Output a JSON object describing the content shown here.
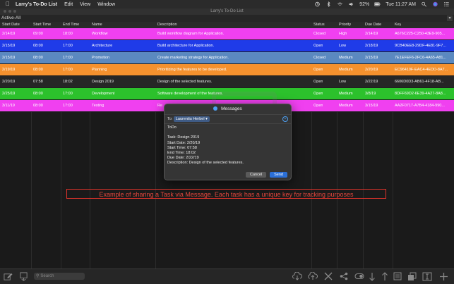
{
  "menubar": {
    "app_name": "Larry's To-Do List",
    "items": [
      "Edit",
      "View",
      "Window"
    ],
    "battery": "92%",
    "clock": "Tue 11:27 AM"
  },
  "window": {
    "title": "Larry's To-Do List"
  },
  "filter": {
    "label": "Active-All"
  },
  "columns": [
    "Start Date",
    "Start Time",
    "End Time",
    "Name",
    "Description",
    "Status",
    "Priority",
    "Due Date",
    "Key"
  ],
  "rows": [
    {
      "start_date": "2/14/19",
      "start_time": "09:00",
      "end_time": "18:00",
      "name": "Workflow",
      "description": "Build workflow diagram for Application.",
      "status": "Closed",
      "priority": "High",
      "due_date": "2/14/19",
      "key": "A676C225-C250-43E9-905...",
      "color": "#f040f0",
      "text_color": "#ffffff"
    },
    {
      "start_date": "2/15/19",
      "start_time": "08:00",
      "end_time": "17:00",
      "name": "Architecture",
      "description": "Build architecture for Application.",
      "status": "Open",
      "priority": "Low",
      "due_date": "2/18/19",
      "key": "9CB40EE8-29DF-4E81-9F7...",
      "color": "#1f3be8",
      "text_color": "#ffffff"
    },
    {
      "start_date": "2/15/19",
      "start_time": "08:00",
      "end_time": "17:00",
      "name": "Promotion",
      "description": "Create marketing strategy for Application.",
      "status": "Closed",
      "priority": "Medium",
      "due_date": "2/15/19",
      "key": "7E1EFEF6-2FC6-4A65-A81...",
      "color": "#5b89c0",
      "text_color": "#ffffff"
    },
    {
      "start_date": "2/19/19",
      "start_time": "08:00",
      "end_time": "17:00",
      "name": "Planning",
      "description": "Prioritizing the features to be developed.",
      "status": "Open",
      "priority": "Medium",
      "due_date": "2/20/19",
      "key": "EC96410F-EAC4-4EDD-8A7...",
      "color": "#f5912e",
      "text_color": "#ffffff"
    },
    {
      "start_date": "2/20/19",
      "start_time": "07:58",
      "end_time": "18:02",
      "name": "Design 2019",
      "description": "Design of the selected features.",
      "status": "Open",
      "priority": "Low",
      "due_date": "2/22/19",
      "key": "6606D0D3-AB61-4F18-AB...",
      "color": "#262626",
      "text_color": "#e8e8e8"
    },
    {
      "start_date": "2/25/19",
      "start_time": "08:00",
      "end_time": "17:00",
      "name": "Development",
      "description": "Software development of the features.",
      "status": "Open",
      "priority": "Medium",
      "due_date": "3/8/19",
      "key": "8DFF69D2-6E39-4A27-8A8...",
      "color": "#2cc12c",
      "text_color": "#ffffff"
    },
    {
      "start_date": "3/11/19",
      "start_time": "08:00",
      "end_time": "17:00",
      "name": "Testing",
      "description": "Re",
      "status": "Open",
      "priority": "Medium",
      "due_date": "3/15/19",
      "key": "AA2F0717-A7B4-4184-990...",
      "color": "#f040f0",
      "text_color": "#ffffff"
    }
  ],
  "dialog": {
    "title": "Messages",
    "to_label": "To:",
    "recipient": "Laurentiu Herbel",
    "body_lines": [
      "ToDo",
      "",
      "Task: Design 2019",
      "Start Date: 2/20/19",
      "Start Time: 07:58",
      "End Time: 18:02",
      "Due Date: 2/22/19",
      "Description: Design of the selected features."
    ],
    "cancel_label": "Cancel",
    "send_label": "Send"
  },
  "caption": "Example of sharing a Task via Message. Each task has a unique key for tracking purposes",
  "search": {
    "placeholder": "Search"
  },
  "toolbar_icons": [
    "edit-icon",
    "export-icon",
    "cloud-download-icon",
    "cloud-upload-icon",
    "delete-icon",
    "share-icon",
    "toggle-icon",
    "sort-down-icon",
    "sort-up-icon",
    "list-icon",
    "copy-icon",
    "text-cursor-icon",
    "add-icon"
  ]
}
